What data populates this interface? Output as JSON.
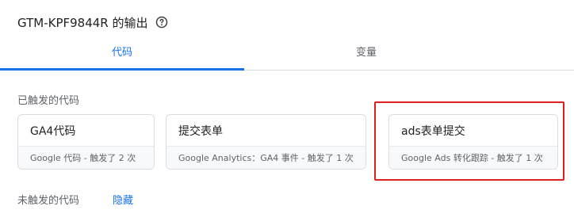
{
  "header": {
    "title": "GTM-KPF9844R 的输出",
    "help_icon": "help-circle-icon"
  },
  "tabs": [
    {
      "label": "代码",
      "active": true
    },
    {
      "label": "变量",
      "active": false
    }
  ],
  "fired_section": {
    "label": "已触发的代码",
    "cards": [
      {
        "name": "GA4代码",
        "meta": "Google 代码 - 触发了 2 次"
      },
      {
        "name": "提交表单",
        "meta": "Google Analytics：GA4 事件 - 触发了 1 次"
      },
      {
        "name": "ads表单提交",
        "meta": "Google Ads 转化跟踪 - 触发了 1 次"
      }
    ]
  },
  "not_fired_section": {
    "label": "未触发的代码",
    "toggle_label": "隐藏"
  },
  "colors": {
    "accent": "#1a73e8",
    "highlight": "#e02020"
  }
}
